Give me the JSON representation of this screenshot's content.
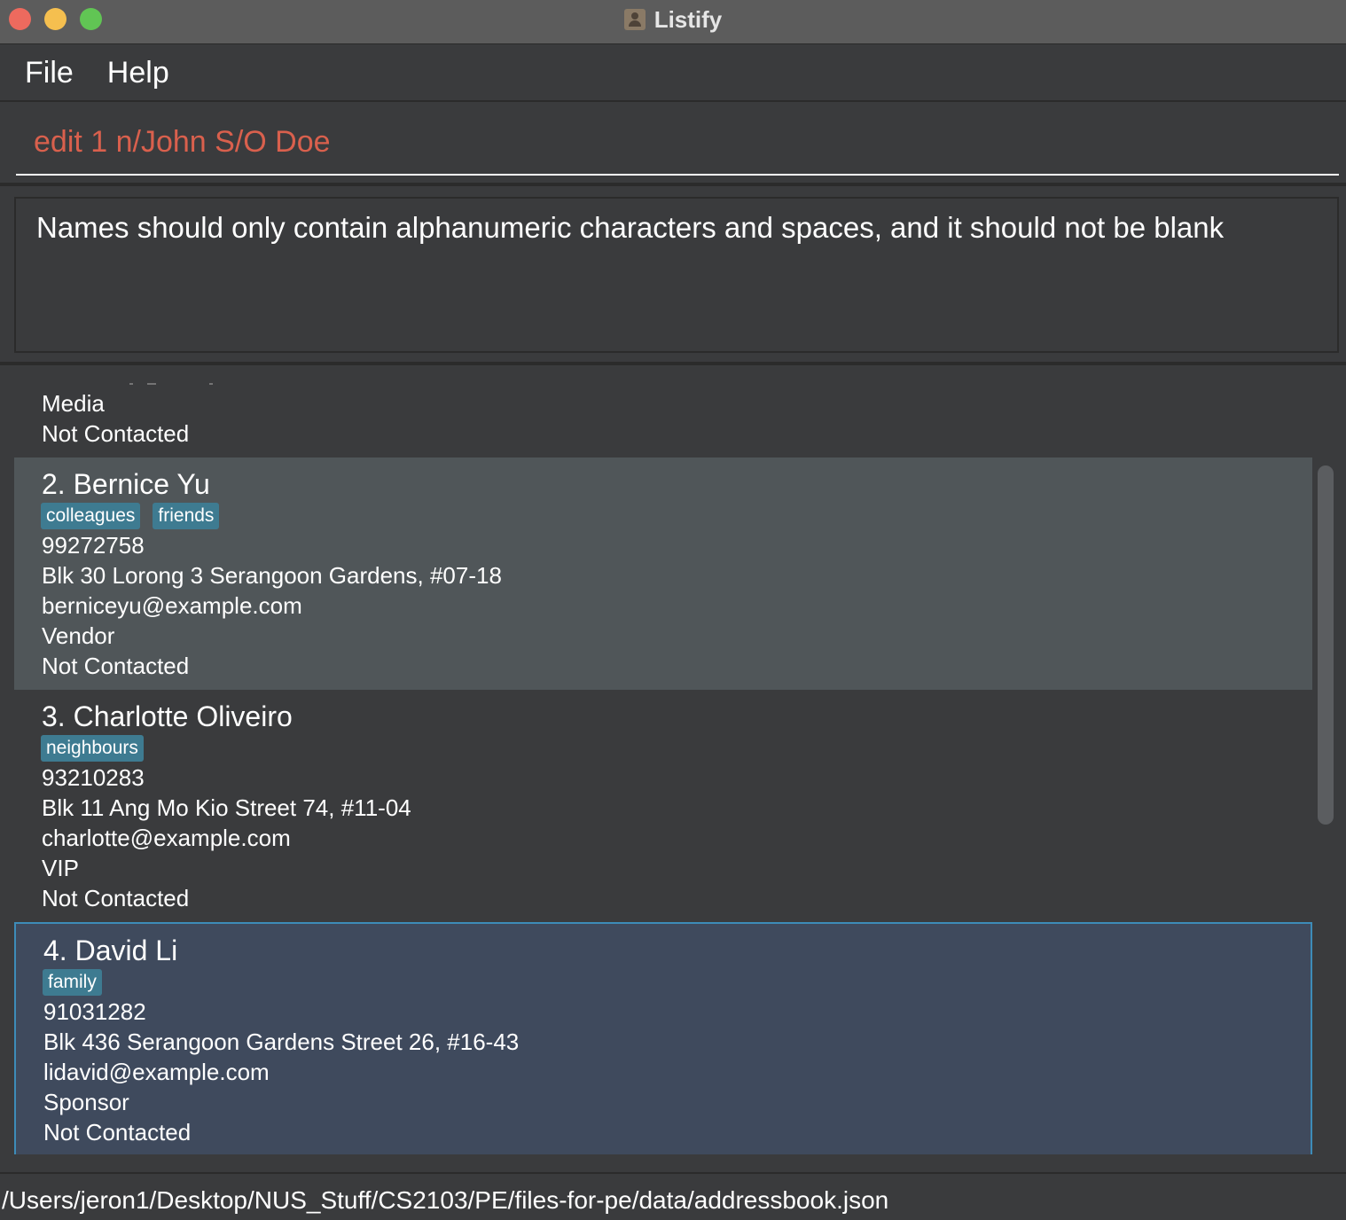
{
  "window": {
    "title": "Listify",
    "app_icon": "contacts-app-icon"
  },
  "menu": {
    "items": [
      "File",
      "Help"
    ]
  },
  "command": {
    "value": "edit 1 n/John S/O Doe",
    "text_color": "#d9604d"
  },
  "result": {
    "message": "Names should only contain alphanumeric characters and spaces, and it should not be blank"
  },
  "persons": {
    "partial": {
      "role": "Media",
      "status": "Not Contacted"
    },
    "cards": [
      {
        "title": "2. Bernice Yu",
        "tags": [
          "colleagues",
          "friends"
        ],
        "phone": "99272758",
        "address": "Blk 30 Lorong 3 Serangoon Gardens, #07-18",
        "email": "berniceyu@example.com",
        "role": "Vendor",
        "status": "Not Contacted"
      },
      {
        "title": "3. Charlotte Oliveiro",
        "tags": [
          "neighbours"
        ],
        "phone": "93210283",
        "address": "Blk 11 Ang Mo Kio Street 74, #11-04",
        "email": "charlotte@example.com",
        "role": "VIP",
        "status": "Not Contacted"
      },
      {
        "title": "4. David Li",
        "tags": [
          "family"
        ],
        "phone": "91031282",
        "address": "Blk 436 Serangoon Gardens Street 26, #16-43",
        "email": "lidavid@example.com",
        "role": "Sponsor",
        "status": "Not Contacted",
        "selected": true
      }
    ]
  },
  "status_bar": {
    "path": "/Users/jeron1/Desktop/NUS_Stuff/CS2103/PE/files-for-pe/data/addressbook.json"
  },
  "colors": {
    "tag_bg": "#3e7b91",
    "selected_bg": "#3f4a5d",
    "selected_border": "#3d8cb8",
    "alt_card_bg": "#505659"
  }
}
